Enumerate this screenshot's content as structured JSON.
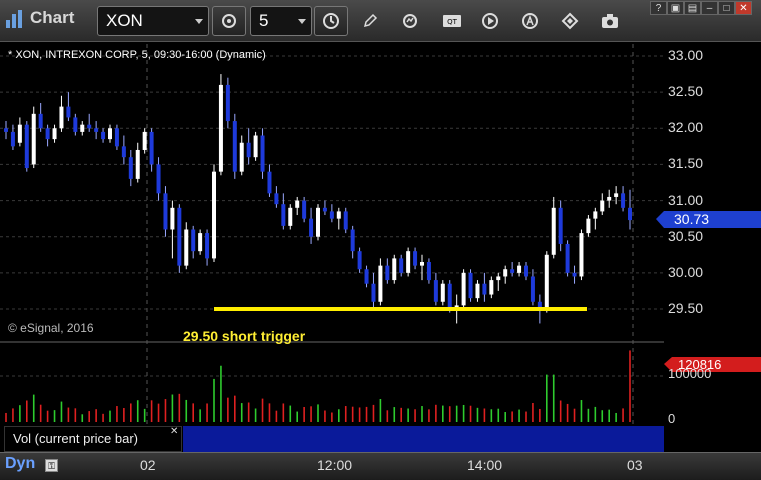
{
  "app": {
    "title": "Chart"
  },
  "toolbar": {
    "symbol": "XON",
    "interval": "5",
    "tools": [
      "pencil-icon",
      "refresh-icon",
      "study-icon",
      "play-icon",
      "font-icon",
      "diamond-icon",
      "camera-icon"
    ]
  },
  "chart": {
    "header": "* XON, INTREXON CORP, 5, 09:30-16:00 (Dynamic)",
    "copyright": "© eSignal, 2016",
    "annotation": "29.50 short trigger",
    "last_price": "30.73",
    "volume_last": "120816",
    "volume_legend": "Vol (current price bar)",
    "dynamic_label": "Dyn",
    "price_ticks": [
      "33.00",
      "32.50",
      "32.00",
      "31.50",
      "31.00",
      "30.50",
      "30.00",
      "29.50"
    ],
    "volume_ticks": [
      "100000",
      "0"
    ],
    "time_labels": [
      "02",
      "12:00",
      "14:00",
      "03"
    ]
  },
  "chart_data": {
    "type": "candlestick",
    "symbol": "XON",
    "interval": "5",
    "ylim": [
      29.3,
      33.1
    ],
    "y_ticks": [
      29.5,
      30.0,
      30.5,
      31.0,
      31.5,
      32.0,
      32.5,
      33.0
    ],
    "x_tick_labels": [
      "02",
      "12:00",
      "14:00",
      "03"
    ],
    "horizontal_line": {
      "value": 29.5,
      "color": "#ffee00",
      "label": "29.50 short trigger"
    },
    "last_price": 30.73,
    "up_color": "#ffffff",
    "down_color": "#1e3adb",
    "candles": [
      [
        32.0,
        32.1,
        31.85,
        31.95
      ],
      [
        31.95,
        32.05,
        31.7,
        31.75
      ],
      [
        31.8,
        32.15,
        31.75,
        32.05
      ],
      [
        32.05,
        32.1,
        31.4,
        31.45
      ],
      [
        31.5,
        32.3,
        31.45,
        32.2
      ],
      [
        32.2,
        32.35,
        31.95,
        32.0
      ],
      [
        32.0,
        32.05,
        31.75,
        31.85
      ],
      [
        31.85,
        32.05,
        31.8,
        32.0
      ],
      [
        32.0,
        32.45,
        31.95,
        32.3
      ],
      [
        32.3,
        32.5,
        32.1,
        32.15
      ],
      [
        32.15,
        32.2,
        31.9,
        31.95
      ],
      [
        31.95,
        32.1,
        31.9,
        32.05
      ],
      [
        32.05,
        32.2,
        31.95,
        32.0
      ],
      [
        32.0,
        32.1,
        31.85,
        31.95
      ],
      [
        31.95,
        32.0,
        31.8,
        31.85
      ],
      [
        31.85,
        32.05,
        31.8,
        32.0
      ],
      [
        32.0,
        32.05,
        31.7,
        31.75
      ],
      [
        31.75,
        31.9,
        31.5,
        31.6
      ],
      [
        31.6,
        31.7,
        31.2,
        31.3
      ],
      [
        31.3,
        31.8,
        31.25,
        31.7
      ],
      [
        31.7,
        32.0,
        31.65,
        31.95
      ],
      [
        31.95,
        32.0,
        31.4,
        31.5
      ],
      [
        31.5,
        31.6,
        31.0,
        31.1
      ],
      [
        31.1,
        31.2,
        30.5,
        30.6
      ],
      [
        30.6,
        31.0,
        30.2,
        30.9
      ],
      [
        30.9,
        30.95,
        30.0,
        30.1
      ],
      [
        30.1,
        30.7,
        30.05,
        30.6
      ],
      [
        30.6,
        30.65,
        30.2,
        30.3
      ],
      [
        30.3,
        30.6,
        30.25,
        30.55
      ],
      [
        30.55,
        30.6,
        30.1,
        30.2
      ],
      [
        30.2,
        31.5,
        30.15,
        31.4
      ],
      [
        31.4,
        32.75,
        31.35,
        32.6
      ],
      [
        32.6,
        32.7,
        32.0,
        32.1
      ],
      [
        32.1,
        32.2,
        31.3,
        31.4
      ],
      [
        31.4,
        31.9,
        31.35,
        31.8
      ],
      [
        31.8,
        32.0,
        31.5,
        31.6
      ],
      [
        31.6,
        31.95,
        31.55,
        31.9
      ],
      [
        31.9,
        32.0,
        31.3,
        31.4
      ],
      [
        31.4,
        31.5,
        31.05,
        31.1
      ],
      [
        31.1,
        31.2,
        30.9,
        30.95
      ],
      [
        30.95,
        31.1,
        30.6,
        30.65
      ],
      [
        30.65,
        30.95,
        30.6,
        30.9
      ],
      [
        30.9,
        31.05,
        30.8,
        31.0
      ],
      [
        31.0,
        31.05,
        30.7,
        30.75
      ],
      [
        30.75,
        30.9,
        30.4,
        30.5
      ],
      [
        30.5,
        30.95,
        30.45,
        30.9
      ],
      [
        30.9,
        31.0,
        30.8,
        30.85
      ],
      [
        30.85,
        30.95,
        30.7,
        30.75
      ],
      [
        30.75,
        30.9,
        30.6,
        30.85
      ],
      [
        30.85,
        30.9,
        30.55,
        30.6
      ],
      [
        30.6,
        30.65,
        30.2,
        30.3
      ],
      [
        30.3,
        30.35,
        30.0,
        30.05
      ],
      [
        30.05,
        30.1,
        29.8,
        29.85
      ],
      [
        29.85,
        30.0,
        29.5,
        29.6
      ],
      [
        29.6,
        30.2,
        29.55,
        30.1
      ],
      [
        30.1,
        30.2,
        29.85,
        29.9
      ],
      [
        29.9,
        30.25,
        29.85,
        30.2
      ],
      [
        30.2,
        30.25,
        29.95,
        30.0
      ],
      [
        30.0,
        30.35,
        29.95,
        30.3
      ],
      [
        30.3,
        30.35,
        30.05,
        30.1
      ],
      [
        30.1,
        30.25,
        29.9,
        30.15
      ],
      [
        30.15,
        30.2,
        29.85,
        29.9
      ],
      [
        29.9,
        30.0,
        29.55,
        29.6
      ],
      [
        29.6,
        29.9,
        29.55,
        29.85
      ],
      [
        29.85,
        29.9,
        29.45,
        29.5
      ],
      [
        29.5,
        29.7,
        29.3,
        29.55
      ],
      [
        29.55,
        30.05,
        29.5,
        30.0
      ],
      [
        30.0,
        30.05,
        29.6,
        29.65
      ],
      [
        29.65,
        29.9,
        29.6,
        29.85
      ],
      [
        29.85,
        30.0,
        29.6,
        29.7
      ],
      [
        29.7,
        29.95,
        29.65,
        29.9
      ],
      [
        29.9,
        30.0,
        29.75,
        29.95
      ],
      [
        29.95,
        30.1,
        29.85,
        30.05
      ],
      [
        30.05,
        30.15,
        29.95,
        30.0
      ],
      [
        30.0,
        30.15,
        29.95,
        30.1
      ],
      [
        30.1,
        30.15,
        29.9,
        29.95
      ],
      [
        29.95,
        30.05,
        29.55,
        29.6
      ],
      [
        29.6,
        29.7,
        29.3,
        29.5
      ],
      [
        29.5,
        30.3,
        29.45,
        30.25
      ],
      [
        30.25,
        31.05,
        30.2,
        30.9
      ],
      [
        30.9,
        31.0,
        30.3,
        30.4
      ],
      [
        30.4,
        30.45,
        29.95,
        30.0
      ],
      [
        30.0,
        30.1,
        29.85,
        29.95
      ],
      [
        29.95,
        30.6,
        29.9,
        30.55
      ],
      [
        30.55,
        30.8,
        30.5,
        30.75
      ],
      [
        30.75,
        30.9,
        30.6,
        30.85
      ],
      [
        30.85,
        31.1,
        30.8,
        31.0
      ],
      [
        31.0,
        31.15,
        30.9,
        31.05
      ],
      [
        31.05,
        31.2,
        30.95,
        31.1
      ],
      [
        31.1,
        31.2,
        30.85,
        30.9
      ],
      [
        30.9,
        31.15,
        30.6,
        30.73
      ]
    ],
    "volume": {
      "ylim": [
        0,
        130000
      ],
      "up_color": "#2ecc2e",
      "down_color": "#e02020",
      "last": 120816
    }
  }
}
